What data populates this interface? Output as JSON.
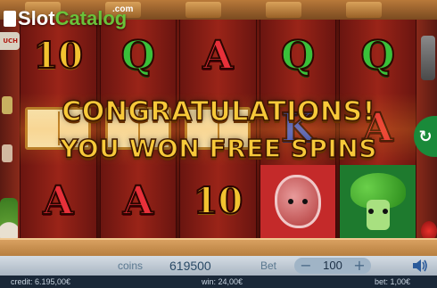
{
  "logo": {
    "brand_slot": "Slot",
    "brand_catalog": "Catalog",
    "brand_tld": ".com",
    "side_badge": "UCH"
  },
  "reels": [
    [
      "10",
      "book",
      "A"
    ],
    [
      "Q",
      "book",
      "A"
    ],
    [
      "A",
      "book",
      "10"
    ],
    [
      "Q",
      "K",
      "meat"
    ],
    [
      "Q",
      "A",
      "broccoli"
    ]
  ],
  "message": {
    "line1": "CONGRATULATIONS!",
    "line2": "YOU WON FREE SPINS"
  },
  "controls": {
    "coins_label": "coins",
    "coins_value": "619500",
    "bet_label": "Bet",
    "bet_value": "100",
    "bet_minus": "−",
    "bet_plus": "+"
  },
  "status": {
    "credit": "credit: 6.195,00€",
    "win": "win: 24,00€",
    "bet": "bet: 1,00€"
  },
  "colors": {
    "ten": "#f2c230",
    "queen": "#3ac03a",
    "ace": "#e8303a",
    "king": "#3a60e0",
    "message": "#f7c93a"
  },
  "icons": {
    "sound": "speaker-icon",
    "spin": "spin-arrow-icon"
  }
}
